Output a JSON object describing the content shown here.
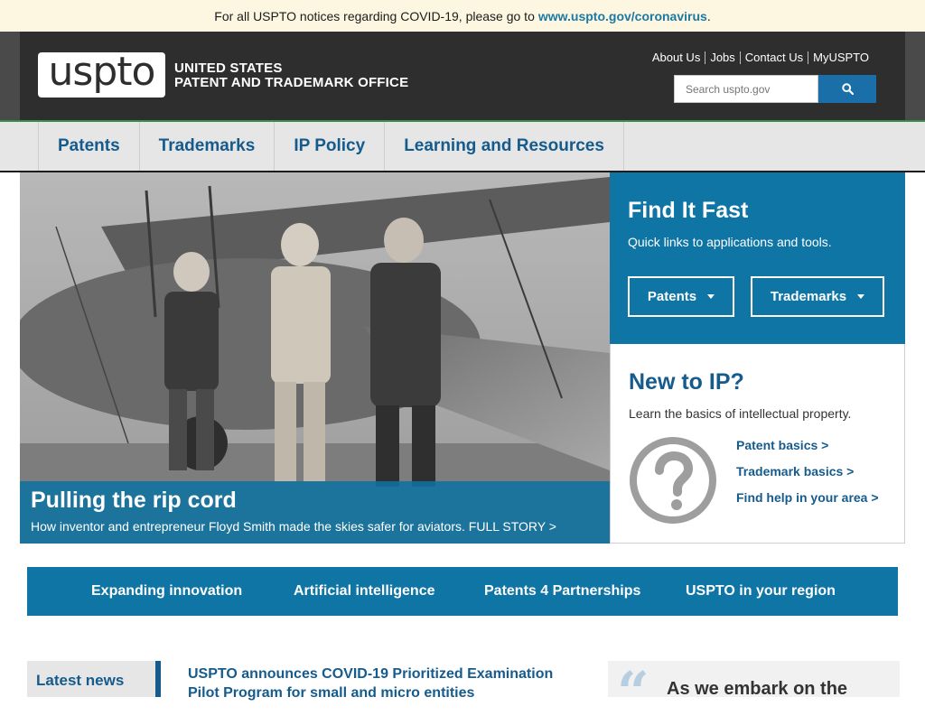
{
  "covid_banner": {
    "text": "For all USPTO notices regarding COVID-19, please go to",
    "link": "www.uspto.gov/coronavirus",
    "end": "."
  },
  "header": {
    "logo": "uspto",
    "agency_line1": "UNITED STATES",
    "agency_line2": "PATENT AND TRADEMARK OFFICE",
    "utility_links": [
      "About Us",
      "Jobs",
      "Contact Us",
      "MyUSPTO"
    ],
    "search_placeholder": "Search uspto.gov",
    "search_icon": "search-icon"
  },
  "main_nav": [
    "Patents",
    "Trademarks",
    "IP Policy",
    "Learning and Resources"
  ],
  "hero": {
    "title": "Pulling the rip cord",
    "subtitle": "How inventor and entrepreneur Floyd Smith made the skies safer for aviators. FULL STORY >"
  },
  "find_it_fast": {
    "title": "Find It Fast",
    "subtitle": "Quick links to applications and tools.",
    "buttons": [
      "Patents",
      "Trademarks"
    ]
  },
  "new_to_ip": {
    "title": "New to IP?",
    "subtitle": "Learn the basics of intellectual property.",
    "icon": "question-circle-icon",
    "links": [
      "Patent basics >",
      "Trademark basics >",
      "Find help in your area >"
    ]
  },
  "topic_bar": [
    "Expanding innovation",
    "Artificial intelligence",
    "Patents 4 Partnerships",
    "USPTO in your region"
  ],
  "latest_news": {
    "label": "Latest news",
    "headline": "USPTO announces COVID-19 Prioritized Examination Pilot Program for small and micro entities"
  },
  "quote": {
    "mark": "“",
    "text": "As we embark on the"
  },
  "colors": {
    "brand_blue": "#0f75a5",
    "link_blue": "#155b8c",
    "header_dark": "#2e2e2e",
    "banner_bg": "#fdf7e1"
  }
}
